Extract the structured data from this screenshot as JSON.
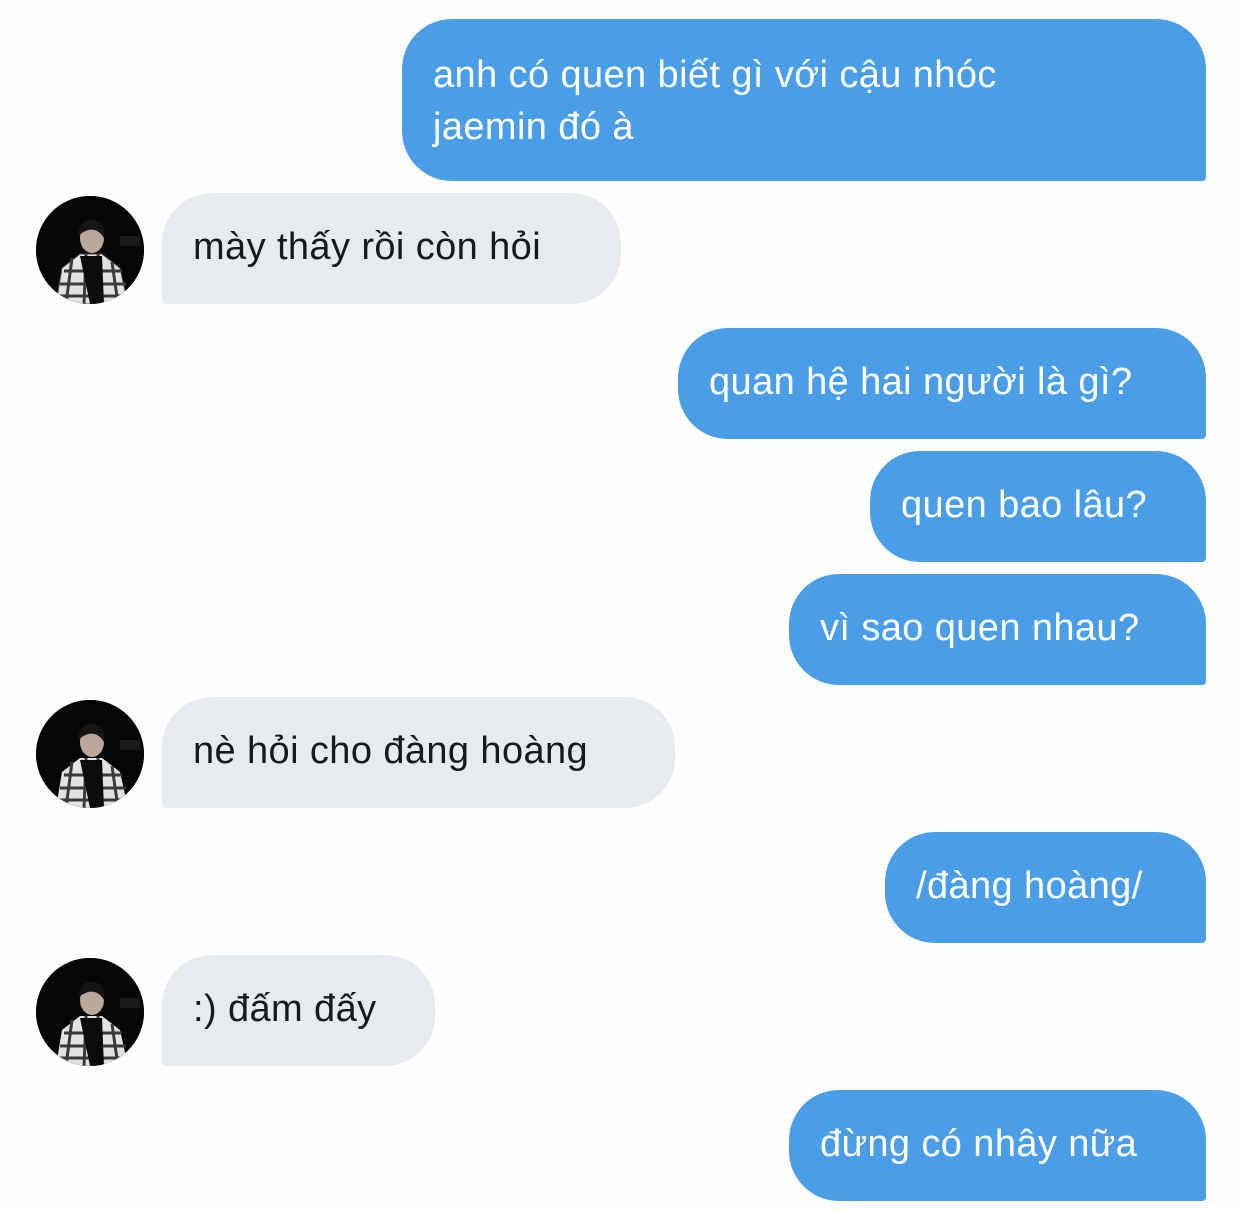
{
  "colors": {
    "sent_bubble": "#4a9de7",
    "received_bubble": "#e7ebf0",
    "background": "#fefefe"
  },
  "messages": [
    {
      "from": "me",
      "lines": [
        "anh có quen biết gì với cậu nhóc",
        "jaemin đó à"
      ]
    },
    {
      "from": "them",
      "text": "mày thấy rồi còn hỏi"
    },
    {
      "from": "me",
      "text": "quan hệ hai người là gì?"
    },
    {
      "from": "me",
      "text": "quen bao lâu?"
    },
    {
      "from": "me",
      "text": "vì sao quen nhau?"
    },
    {
      "from": "them",
      "text": "nè hỏi cho đàng hoàng"
    },
    {
      "from": "me",
      "text": "/đàng hoàng/"
    },
    {
      "from": "them",
      "text": ":) đấm đấy"
    },
    {
      "from": "me",
      "text": "đừng có nhây nữa"
    }
  ]
}
